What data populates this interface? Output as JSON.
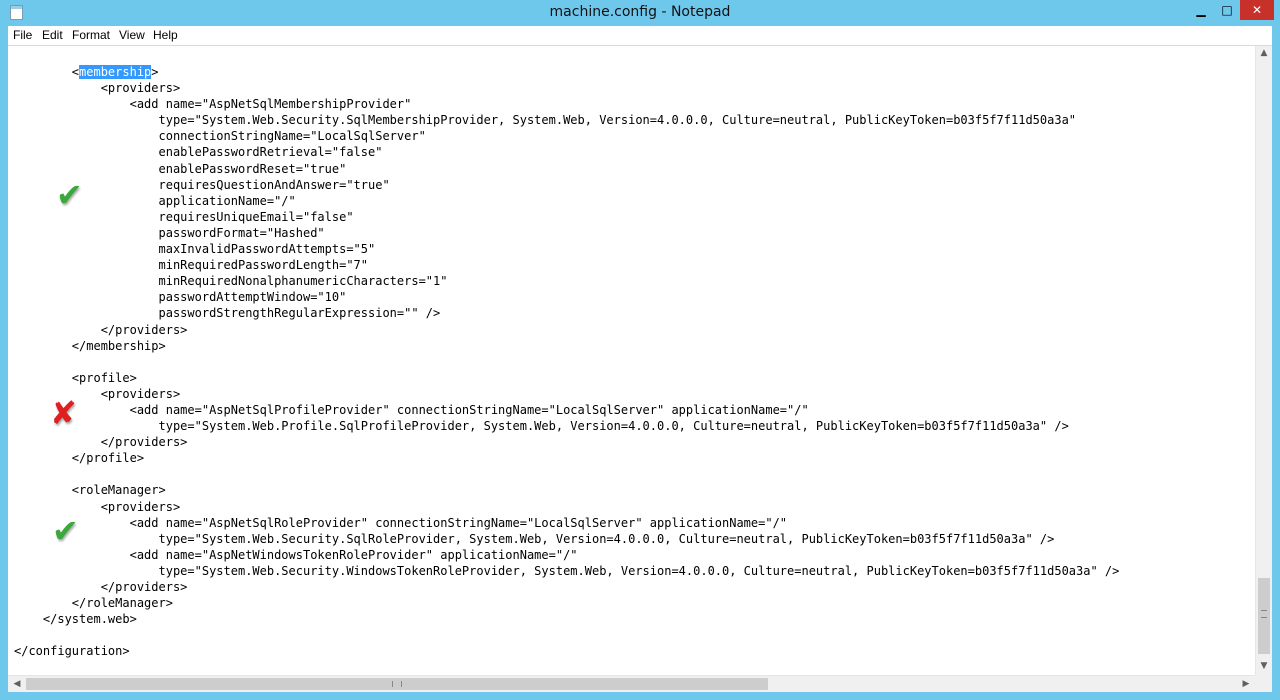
{
  "window": {
    "title": "machine.config - Notepad",
    "controls": {
      "minimize": "▁",
      "maximize": "□",
      "close": "✕"
    }
  },
  "menu": [
    "File",
    "Edit",
    "Format",
    "View",
    "Help"
  ],
  "editor": {
    "selected_text": "membership",
    "lines": [
      "        <",
      "            <providers>",
      "                <add name=\"AspNetSqlMembershipProvider\"",
      "                    type=\"System.Web.Security.SqlMembershipProvider, System.Web, Version=4.0.0.0, Culture=neutral, PublicKeyToken=b03f5f7f11d50a3a\"",
      "                    connectionStringName=\"LocalSqlServer\"",
      "                    enablePasswordRetrieval=\"false\"",
      "                    enablePasswordReset=\"true\"",
      "                    requiresQuestionAndAnswer=\"true\"",
      "                    applicationName=\"/\"",
      "                    requiresUniqueEmail=\"false\"",
      "                    passwordFormat=\"Hashed\"",
      "                    maxInvalidPasswordAttempts=\"5\"",
      "                    minRequiredPasswordLength=\"7\"",
      "                    minRequiredNonalphanumericCharacters=\"1\"",
      "                    passwordAttemptWindow=\"10\"",
      "                    passwordStrengthRegularExpression=\"\" />",
      "            </providers>",
      "        </membership>",
      "",
      "        <profile>",
      "            <providers>",
      "                <add name=\"AspNetSqlProfileProvider\" connectionStringName=\"LocalSqlServer\" applicationName=\"/\"",
      "                    type=\"System.Web.Profile.SqlProfileProvider, System.Web, Version=4.0.0.0, Culture=neutral, PublicKeyToken=b03f5f7f11d50a3a\" />",
      "            </providers>",
      "        </profile>",
      "",
      "        <roleManager>",
      "            <providers>",
      "                <add name=\"AspNetSqlRoleProvider\" connectionStringName=\"LocalSqlServer\" applicationName=\"/\"",
      "                    type=\"System.Web.Security.SqlRoleProvider, System.Web, Version=4.0.0.0, Culture=neutral, PublicKeyToken=b03f5f7f11d50a3a\" />",
      "                <add name=\"AspNetWindowsTokenRoleProvider\" applicationName=\"/\"",
      "                    type=\"System.Web.Security.WindowsTokenRoleProvider, System.Web, Version=4.0.0.0, Culture=neutral, PublicKeyToken=b03f5f7f11d50a3a\" />",
      "            </providers>",
      "        </roleManager>",
      "    </system.web>",
      "",
      "</configuration>"
    ],
    "first_line_suffix": ">"
  },
  "annotations": {
    "membership_mark": "✔",
    "profile_mark": "✘",
    "rolemanager_mark": "✔"
  },
  "colors": {
    "titlebar": "#6ec8ec",
    "selection": "#3399ff",
    "check": "#3aa83a",
    "cross": "#e02020",
    "close_button": "#c7312a"
  }
}
